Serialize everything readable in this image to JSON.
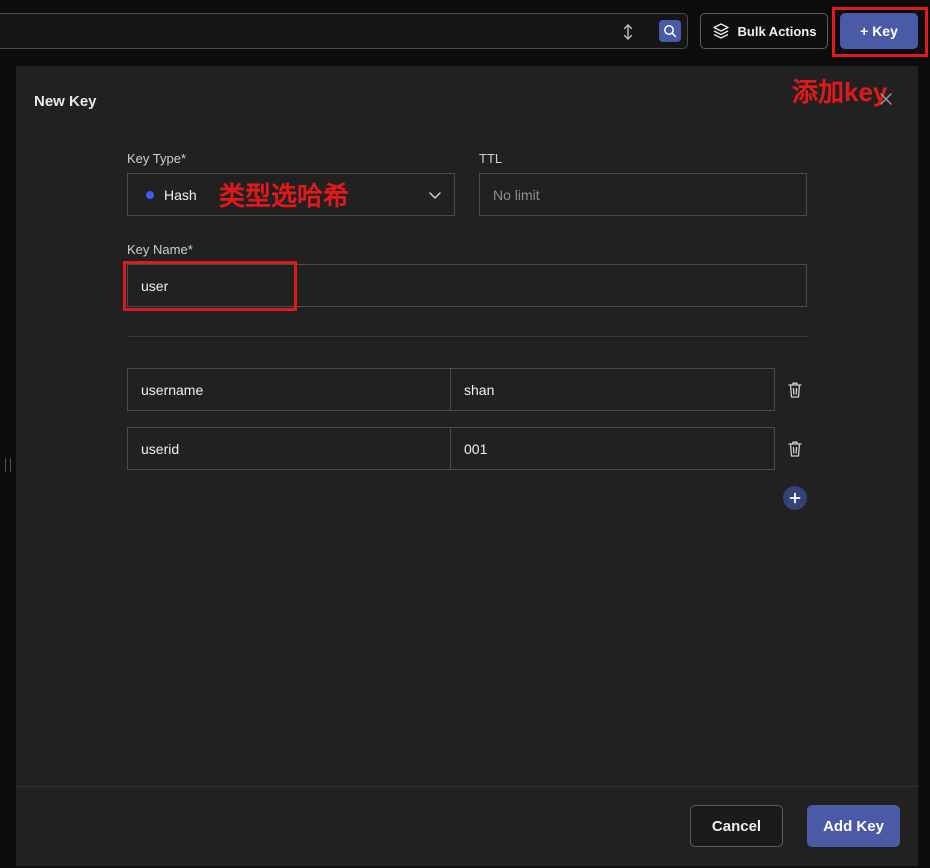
{
  "topbar": {
    "bulk_actions_label": "Bulk Actions",
    "add_key_label": "+ Key",
    "icons": [
      "sort-icon",
      "search-icon",
      "layers-icon"
    ]
  },
  "panel": {
    "title": "New Key",
    "key_type": {
      "label": "Key Type*",
      "value": "Hash",
      "dot_color": "#3d5afe"
    },
    "ttl": {
      "label": "TTL",
      "placeholder": "No limit"
    },
    "key_name": {
      "label": "Key Name*",
      "value": "user"
    },
    "fields": [
      {
        "field": "username",
        "value": "shan"
      },
      {
        "field": "userid",
        "value": "001"
      }
    ],
    "cancel_label": "Cancel",
    "submit_label": "Add Key"
  },
  "annotations": {
    "add_key_note": "添加key",
    "type_note": "类型选哈希",
    "color": "#e0191b"
  },
  "colors": {
    "accent": "#4a5aa6",
    "panel_bg": "#212121",
    "page_bg": "#0d0d0d"
  }
}
